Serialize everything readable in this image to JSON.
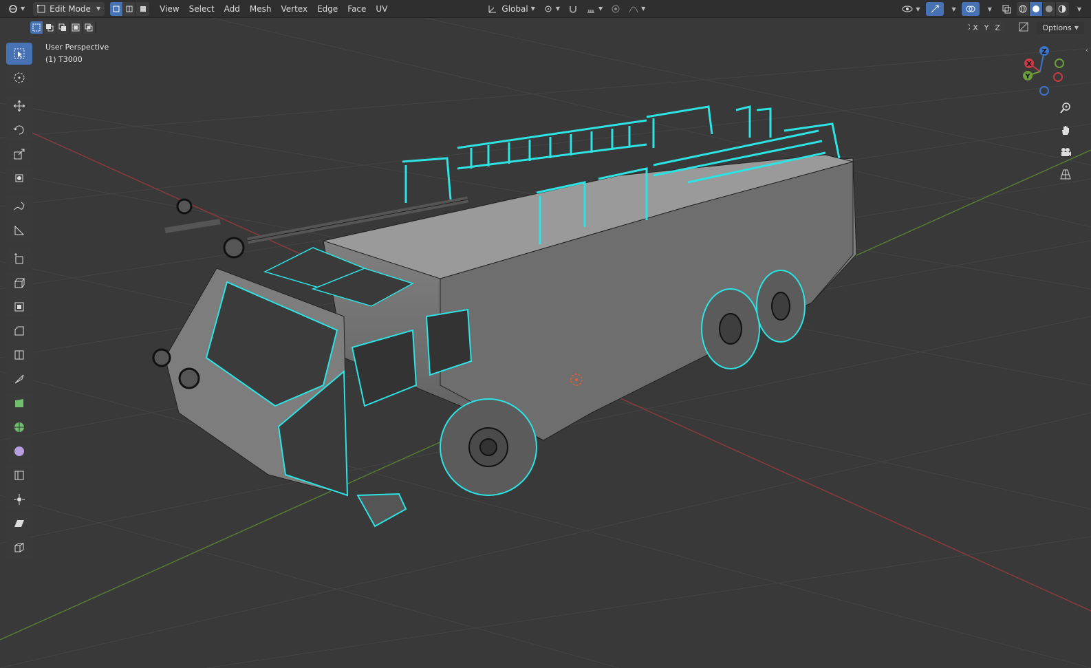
{
  "header": {
    "editor_type_icon": "3d-viewport-icon",
    "mode": "Edit Mode",
    "menus": [
      "View",
      "Select",
      "Add",
      "Mesh",
      "Vertex",
      "Edge",
      "Face",
      "UV"
    ],
    "transform_orientation": "Global"
  },
  "toolbar2": {
    "axis_labels": [
      "X",
      "Y",
      "Z"
    ],
    "options_label": "Options"
  },
  "viewport": {
    "perspective_label": "User Perspective",
    "object_label": "(1) T3000"
  },
  "gizmo": {
    "x": "X",
    "y": "Y",
    "z": "Z"
  },
  "colors": {
    "accent": "#4772b3",
    "selected_edge": "#2de3e3",
    "x_axis": "#c83a45",
    "y_axis": "#6c9e3b",
    "z_axis": "#3b74c8"
  },
  "tools": [
    "select-box-icon",
    "cursor-icon",
    "move-icon",
    "rotate-icon",
    "scale-icon",
    "transform-icon",
    "annotate-icon",
    "measure-icon",
    "add-cube-icon",
    "extrude-icon",
    "inset-icon",
    "bevel-icon",
    "loop-cut-icon",
    "knife-icon",
    "poly-build-icon",
    "spin-icon",
    "smooth-icon",
    "edge-slide-icon",
    "shrink-fatten-icon",
    "shear-icon",
    "rip-icon"
  ]
}
